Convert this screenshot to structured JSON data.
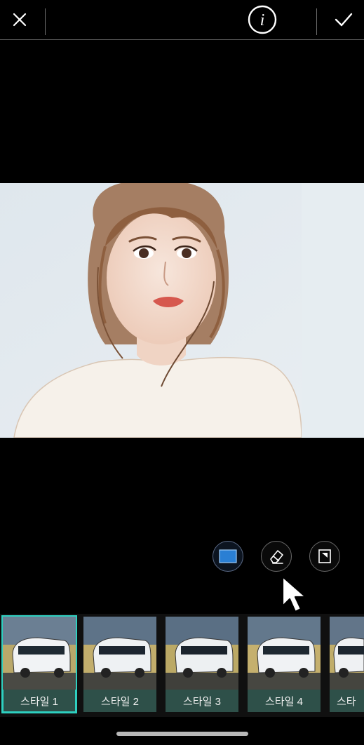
{
  "toolbar": {
    "close_icon": "close-icon",
    "info_icon": "info-icon",
    "done_icon": "checkmark-icon",
    "info_glyph": "i"
  },
  "tools": {
    "fill_icon": "fill-selection-icon",
    "eraser_icon": "eraser-icon",
    "invert_icon": "invert-selection-icon"
  },
  "styles": {
    "items": [
      {
        "label": "스타일 1",
        "selected": true
      },
      {
        "label": "스타일 2",
        "selected": false
      },
      {
        "label": "스타일 3",
        "selected": false
      },
      {
        "label": "스타일 4",
        "selected": false
      },
      {
        "label": "스타",
        "selected": false
      }
    ]
  },
  "colors": {
    "accent": "#2ed0c0",
    "label_bg": "#2e5049",
    "background": "#000000"
  }
}
